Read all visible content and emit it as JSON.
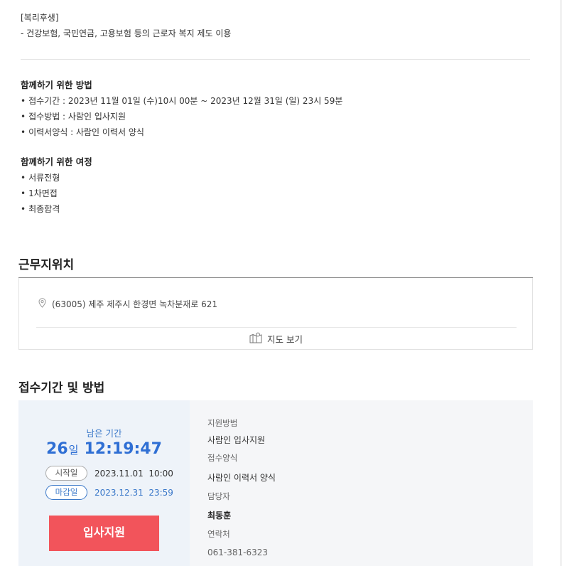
{
  "benefits": {
    "heading": "[복리후생]",
    "line": "- 건강보험, 국민연금, 고용보험 등의 근로자 복지 제도 이용"
  },
  "method": {
    "heading": "함께하기 위한 방법",
    "items": [
      "접수기간 : 2023년 11월 01일 (수)10시 00분 ~ 2023년 12월 31일 (일) 23시 59분",
      "접수방법 : 사람인 입사지원",
      "이력서양식 : 사람인 이력서 양식"
    ]
  },
  "journey": {
    "heading": "함께하기 위한 여정",
    "items": [
      "서류전형",
      "1차면접",
      "최종합격"
    ]
  },
  "location": {
    "title": "근무지위치",
    "address": "(63005) 제주 제주시 한경면 녹차분재로 621",
    "map_link": "지도 보기",
    "icons": {
      "pin": "map-pin-icon",
      "map": "map-icon"
    }
  },
  "apply": {
    "title": "접수기간 및 방법",
    "remaining_label": "남은 기간",
    "remaining_days": "26",
    "days_unit": "일",
    "remaining_time": "12:19:47",
    "start_label": "시작일",
    "start_value": "2023.11.01  10:00",
    "end_label": "마감일",
    "end_value": "2023.12.31  23:59",
    "button_label": "입사지원",
    "details": {
      "method_label": "지원방법",
      "method_value": "사람인 입사지원",
      "form_label": "접수양식",
      "form_value": "사람인 이력서 양식",
      "manager_label": "담당자",
      "manager_value": "최동훈",
      "contact_label": "연락처",
      "contact_value": "061-381-6323"
    },
    "colors": {
      "accent": "#2f6fd4",
      "button": "#f2545b"
    }
  }
}
